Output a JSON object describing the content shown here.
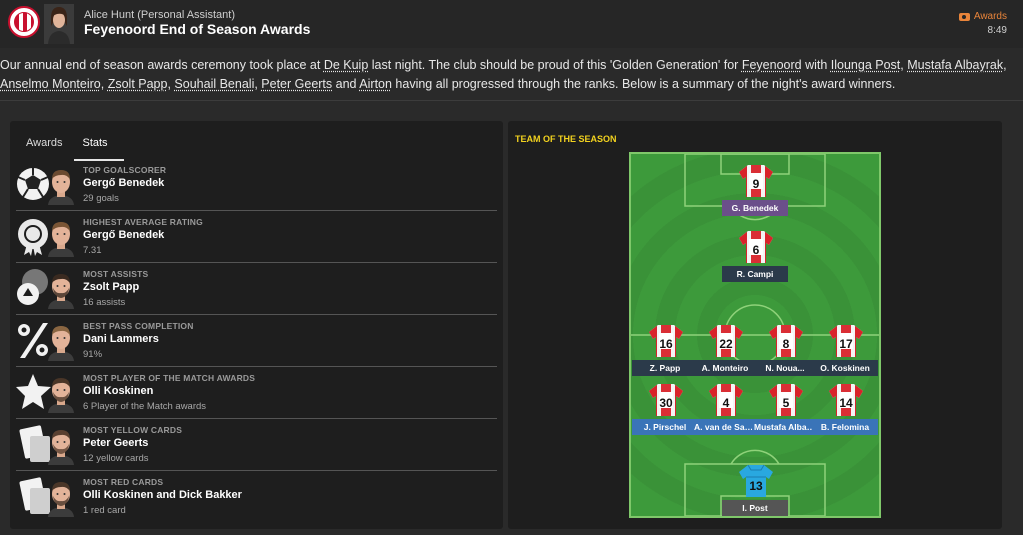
{
  "header": {
    "sender": "Alice Hunt  (Personal Assistant)",
    "subject": "Feyenoord End of Season Awards",
    "tag": "Awards",
    "time": "8:49"
  },
  "message": {
    "p1": "Our annual end of season awards ceremony took place at ",
    "link_stadium": "De Kuip",
    "p2": " last night. The club should be proud of this 'Golden Generation' for ",
    "link_club": "Feyenoord",
    "p3": " with ",
    "link_p1": "Ilounga Post",
    "sep1": ", ",
    "link_p2": "Mustafa Albayrak",
    "sep2": ", ",
    "link_p3": "Anselmo Monteiro",
    "sep3": ", ",
    "link_p4": "Zsolt Papp",
    "sep4": ", ",
    "link_p5": "Souhail Benali",
    "sep5": ", ",
    "link_p6": "Peter Geerts",
    "p4": " and ",
    "link_p7": "Airton",
    "p5": " having all progressed through the ranks. Below is a summary of the night's award winners."
  },
  "tabs": [
    {
      "label": "Awards"
    },
    {
      "label": "Stats"
    }
  ],
  "awards": [
    {
      "category": "TOP GOALSCORER",
      "player": "Gergő Benedek",
      "detail": "29 goals",
      "icon": "football-icon"
    },
    {
      "category": "HIGHEST AVERAGE RATING",
      "player": "Gergő Benedek",
      "detail": "7.31",
      "icon": "rosette-icon"
    },
    {
      "category": "MOST ASSISTS",
      "player": "Zsolt Papp",
      "detail": "16 assists",
      "icon": "assist-icon"
    },
    {
      "category": "BEST PASS COMPLETION",
      "player": "Dani Lammers",
      "detail": "91%",
      "icon": "percent-icon"
    },
    {
      "category": "MOST PLAYER OF THE MATCH AWARDS",
      "player": "Olli Koskinen",
      "detail": "6 Player of the Match awards",
      "icon": "star-icon"
    },
    {
      "category": "MOST YELLOW CARDS",
      "player": "Peter Geerts",
      "detail": "12 yellow cards",
      "icon": "card-icon"
    },
    {
      "category": "MOST RED CARDS",
      "player": "Olli Koskinen and Dick Bakker",
      "detail": "1 red card",
      "icon": "card-icon"
    }
  ],
  "team_of_season": {
    "title": "TEAM OF THE SEASON",
    "players": [
      {
        "number": "9",
        "name": "G. Benedek",
        "role": "attack",
        "kit": "outfield"
      },
      {
        "number": "6",
        "name": "R. Campi",
        "role": "midfield",
        "kit": "outfield"
      },
      {
        "number": "16",
        "name": "Z. Papp",
        "role": "midfield",
        "kit": "outfield"
      },
      {
        "number": "22",
        "name": "A. Monteiro",
        "role": "midfield",
        "kit": "outfield"
      },
      {
        "number": "8",
        "name": "N. Noua...",
        "role": "midfield",
        "kit": "outfield"
      },
      {
        "number": "17",
        "name": "O. Koskinen",
        "role": "midfield",
        "kit": "outfield"
      },
      {
        "number": "30",
        "name": "J. Pirschel",
        "role": "defence",
        "kit": "outfield"
      },
      {
        "number": "4",
        "name": "A. van de Sande",
        "role": "defence",
        "kit": "outfield"
      },
      {
        "number": "5",
        "name": "Mustafa Albay...",
        "role": "defence",
        "kit": "outfield"
      },
      {
        "number": "14",
        "name": "B. Felomina",
        "role": "defence",
        "kit": "outfield"
      },
      {
        "number": "13",
        "name": "I. Post",
        "role": "goalkeeper",
        "kit": "goalkeeper"
      }
    ]
  },
  "colors": {
    "accent": "#e8843a",
    "tots_title": "#f3d31f",
    "attack_plate": "#6b4f8a",
    "midfield_plate": "#2b3a4a",
    "defence_plate": "#3a74b8",
    "goalkeeper_plate": "#555555",
    "shirt_red": "#d8232a",
    "keeper_shirt": "#29a8e0"
  }
}
